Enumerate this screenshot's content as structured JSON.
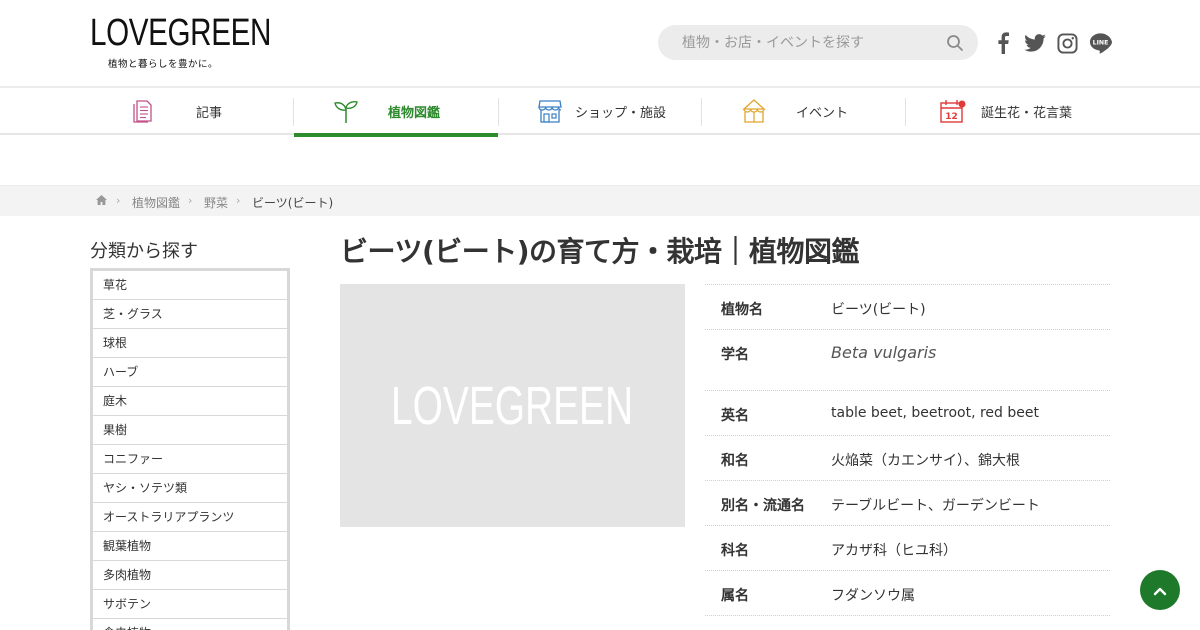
{
  "header": {
    "logo_text": "LOVEGREEN",
    "tagline": "植物と暮らしを豊かに。",
    "search_placeholder": "植物・お店・イベントを探す",
    "social_icons": [
      "facebook-icon",
      "twitter-icon",
      "instagram-icon",
      "line-icon"
    ]
  },
  "nav": {
    "items": [
      {
        "label": "記事",
        "icon": "article-icon",
        "active": false
      },
      {
        "label": "植物図鑑",
        "icon": "sprout-icon",
        "active": true
      },
      {
        "label": "ショップ・施設",
        "icon": "shop-icon",
        "active": false
      },
      {
        "label": "イベント",
        "icon": "tent-icon",
        "active": false
      },
      {
        "label": "誕生花・花言葉",
        "icon": "calendar-icon",
        "active": false
      }
    ],
    "accent_color": "#2e8b2e"
  },
  "breadcrumb": {
    "home_icon": "home-icon",
    "items": [
      "植物図鑑",
      "野菜",
      "ビーツ(ビート)"
    ]
  },
  "sidebar": {
    "title": "分類から探す",
    "categories": [
      "草花",
      "芝・グラス",
      "球根",
      "ハーブ",
      "庭木",
      "果樹",
      "コニファー",
      "ヤシ・ソテツ類",
      "オーストラリアプランツ",
      "観葉植物",
      "多肉植物",
      "サボテン",
      "食虫植物"
    ]
  },
  "main": {
    "title": "ビーツ(ビート)の育て方・栽培｜植物図鑑",
    "photo_placeholder_text": "LOVEGREEN",
    "info": [
      {
        "key": "植物名",
        "value": "ビーツ(ビート)"
      },
      {
        "key": "学名",
        "value": "Beta vulgaris"
      },
      {
        "key": "英名",
        "value": "table beet, beetroot, red beet"
      },
      {
        "key": "和名",
        "value": "火焔菜（カエンサイ）、錦大根"
      },
      {
        "key": "別名・流通名",
        "value": "テーブルビート、ガーデンビート"
      },
      {
        "key": "科名",
        "value": "アカザ科（ヒユ科）"
      },
      {
        "key": "属名",
        "value": "フダンソウ属"
      }
    ]
  },
  "to_top_icon": "chevron-up-icon"
}
